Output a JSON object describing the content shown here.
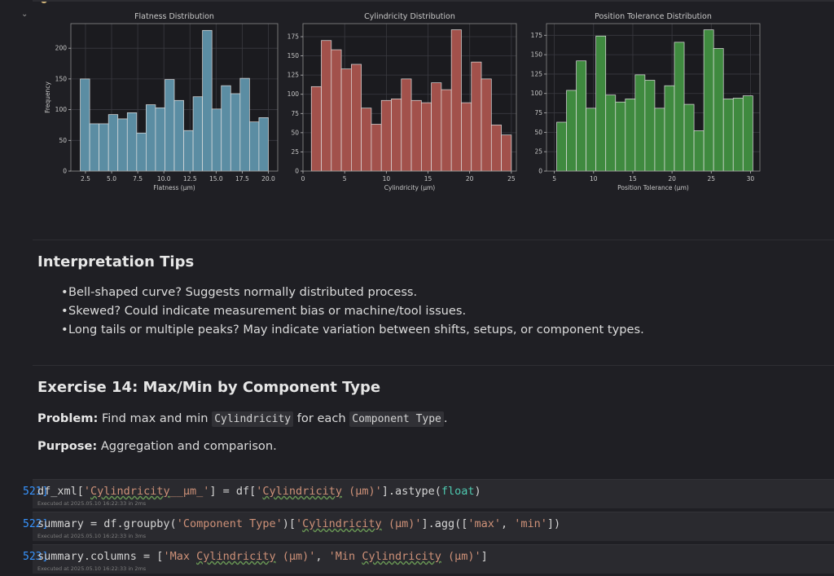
{
  "charts": [
    {
      "title": "Flatness Distribution",
      "xlabel": "Flatness (µm)",
      "ylabel": "Frequency",
      "color": "#5b8da3",
      "xticks": [
        "2.5",
        "5.0",
        "7.5",
        "10.0",
        "12.5",
        "15.0",
        "17.5",
        "20.0"
      ],
      "yticks": [
        "0",
        "50",
        "100",
        "150",
        "200"
      ]
    },
    {
      "title": "Cylindricity Distribution",
      "xlabel": "Cylindricity (µm)",
      "ylabel": "",
      "color": "#a2514b",
      "xticks": [
        "0",
        "5",
        "10",
        "15",
        "20",
        "25"
      ],
      "yticks": [
        "0",
        "25",
        "50",
        "75",
        "100",
        "125",
        "150",
        "175"
      ]
    },
    {
      "title": "Position Tolerance Distribution",
      "xlabel": "Position Tolerance (µm)",
      "ylabel": "",
      "color": "#3f8a3f",
      "xticks": [
        "5",
        "10",
        "15",
        "20",
        "25",
        "30"
      ],
      "yticks": [
        "0",
        "25",
        "50",
        "75",
        "100",
        "125",
        "150",
        "175"
      ]
    }
  ],
  "chart_data": [
    {
      "type": "bar",
      "title": "Flatness Distribution",
      "xlabel": "Flatness (µm)",
      "ylabel": "Frequency",
      "xlim": [
        1.1,
        20.9
      ],
      "ylim": [
        0,
        240
      ],
      "bin_start": 2.0,
      "bin_width": 0.9,
      "values": [
        150,
        77,
        77,
        92,
        85,
        95,
        62,
        108,
        103,
        149,
        115,
        66,
        121,
        229,
        101,
        139,
        126,
        151,
        80,
        87
      ]
    },
    {
      "type": "bar",
      "title": "Cylindricity Distribution",
      "xlabel": "Cylindricity (µm)",
      "ylabel": "",
      "xlim": [
        0,
        25.6
      ],
      "ylim": [
        0,
        192
      ],
      "bin_start": 1.0,
      "bin_width": 1.2,
      "values": [
        110,
        170,
        158,
        133,
        139,
        82,
        61,
        92,
        94,
        120,
        92,
        89,
        115,
        106,
        184,
        89,
        142,
        120,
        60,
        47
      ]
    },
    {
      "type": "bar",
      "title": "Position Tolerance Distribution",
      "xlabel": "Position Tolerance (µm)",
      "ylabel": "",
      "xlim": [
        4.0,
        31.2
      ],
      "ylim": [
        0,
        190
      ],
      "bin_start": 5.3,
      "bin_width": 1.25,
      "values": [
        63,
        104,
        142,
        81,
        174,
        98,
        89,
        93,
        124,
        117,
        81,
        110,
        166,
        86,
        52,
        182,
        158,
        93,
        94,
        97
      ]
    }
  ],
  "tips": {
    "heading": "Interpretation Tips",
    "items": [
      "Bell-shaped curve? Suggests normally distributed process.",
      "Skewed? Could indicate measurement bias or machine/tool issues.",
      "Long tails or multiple peaks? May indicate variation between shifts, setups, or component types."
    ]
  },
  "exercise": {
    "heading": "Exercise 14: Max/Min by Component Type",
    "problem_label": "Problem:",
    "problem_text_1": "Find max and min",
    "problem_code_1": "Cylindricity",
    "problem_text_2": "for each",
    "problem_code_2": "Component Type",
    "problem_text_3": ".",
    "purpose_label": "Purpose:",
    "purpose_text": "Aggregation and comparison."
  },
  "cells": [
    {
      "number": "521]",
      "line": "1",
      "parts": [
        "df_xml[",
        "'",
        "Cylindricity",
        "__μm_",
        "'",
        "] = df[",
        "'",
        "Cylindricity",
        " (μm)",
        "'",
        "].astype(",
        "float",
        ")"
      ],
      "executed": "Executed at 2025.05.10 16:22:33 in 2ms"
    },
    {
      "number": "522]",
      "line": "1",
      "parts": [
        "summary = df.groupby(",
        "'Component Type'",
        ")[",
        "'",
        "Cylindricity",
        " (μm)'",
        "].agg([",
        "'max'",
        ", ",
        "'min'",
        "])"
      ],
      "executed": "Executed at 2025.05.10 16:22:33 in 3ms"
    },
    {
      "number": "523]",
      "line": "1",
      "parts": [
        "summary.columns = [",
        "'Max ",
        "Cylindricity",
        " (μm)'",
        ", ",
        "'Min ",
        "Cylindricity",
        " (μm)'",
        "]"
      ],
      "executed": "Executed at 2025.05.10 16:22:33 in 2ms"
    }
  ]
}
